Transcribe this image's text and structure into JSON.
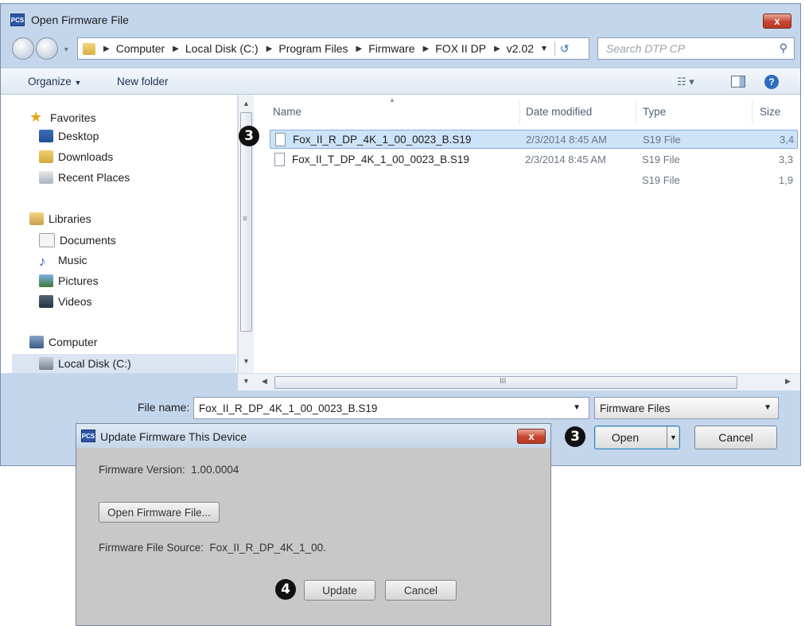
{
  "open_dialog": {
    "title": "Open Firmware File",
    "app_icon_text": "PCS",
    "close_glyph": "x",
    "breadcrumb": [
      "Computer",
      "Local Disk (C:)",
      "Program Files",
      "Firmware",
      "FOX II DP",
      "v2.02"
    ],
    "search_placeholder": "Search DTP CP",
    "toolbar": {
      "organize": "Organize",
      "new_folder": "New folder"
    },
    "nav": {
      "favorites": "Favorites",
      "favorites_items": [
        "Desktop",
        "Downloads",
        "Recent Places"
      ],
      "libraries": "Libraries",
      "libraries_items": [
        "Documents",
        "Music",
        "Pictures",
        "Videos"
      ],
      "computer": "Computer",
      "computer_items": [
        "Local Disk (C:)"
      ]
    },
    "columns": {
      "name": "Name",
      "date": "Date modified",
      "type": "Type",
      "size": "Size"
    },
    "files": [
      {
        "name": "Fox_II_R_DP_4K_1_00_0023_B.S19",
        "date": "2/3/2014 8:45 AM",
        "type": "S19 File",
        "size": "3,4"
      },
      {
        "name": "Fox_II_T_DP_4K_1_00_0023_B.S19",
        "date": "2/3/2014 8:45 AM",
        "type": "S19 File",
        "size": "3,3"
      },
      {
        "name": "",
        "date": "",
        "type": "S19 File",
        "size": "1,9"
      }
    ],
    "h_scroll_grip": "III",
    "v_scroll_grip": "≡",
    "file_name_label": "File name:",
    "file_name_value": "Fox_II_R_DP_4K_1_00_0023_B.S19",
    "filter_value": "Firmware Files",
    "open_button": "Open",
    "cancel_button": "Cancel"
  },
  "update_dialog": {
    "title": "Update Firmware This Device",
    "app_icon_text": "PCS",
    "close_glyph": "x",
    "firmware_version_label": "Firmware Version:",
    "firmware_version_value": "1.00.0004",
    "open_file_button": "Open Firmware File...",
    "source_label": "Firmware File Source:",
    "source_value": "Fox_II_R_DP_4K_1_00.",
    "update_button": "Update",
    "cancel_button": "Cancel"
  },
  "callouts": [
    "3",
    "3",
    "4"
  ],
  "colors": {
    "chrome": "#c3d6ec",
    "selection": "#cde3f8",
    "close": "#c64530",
    "badge": "#111111"
  }
}
